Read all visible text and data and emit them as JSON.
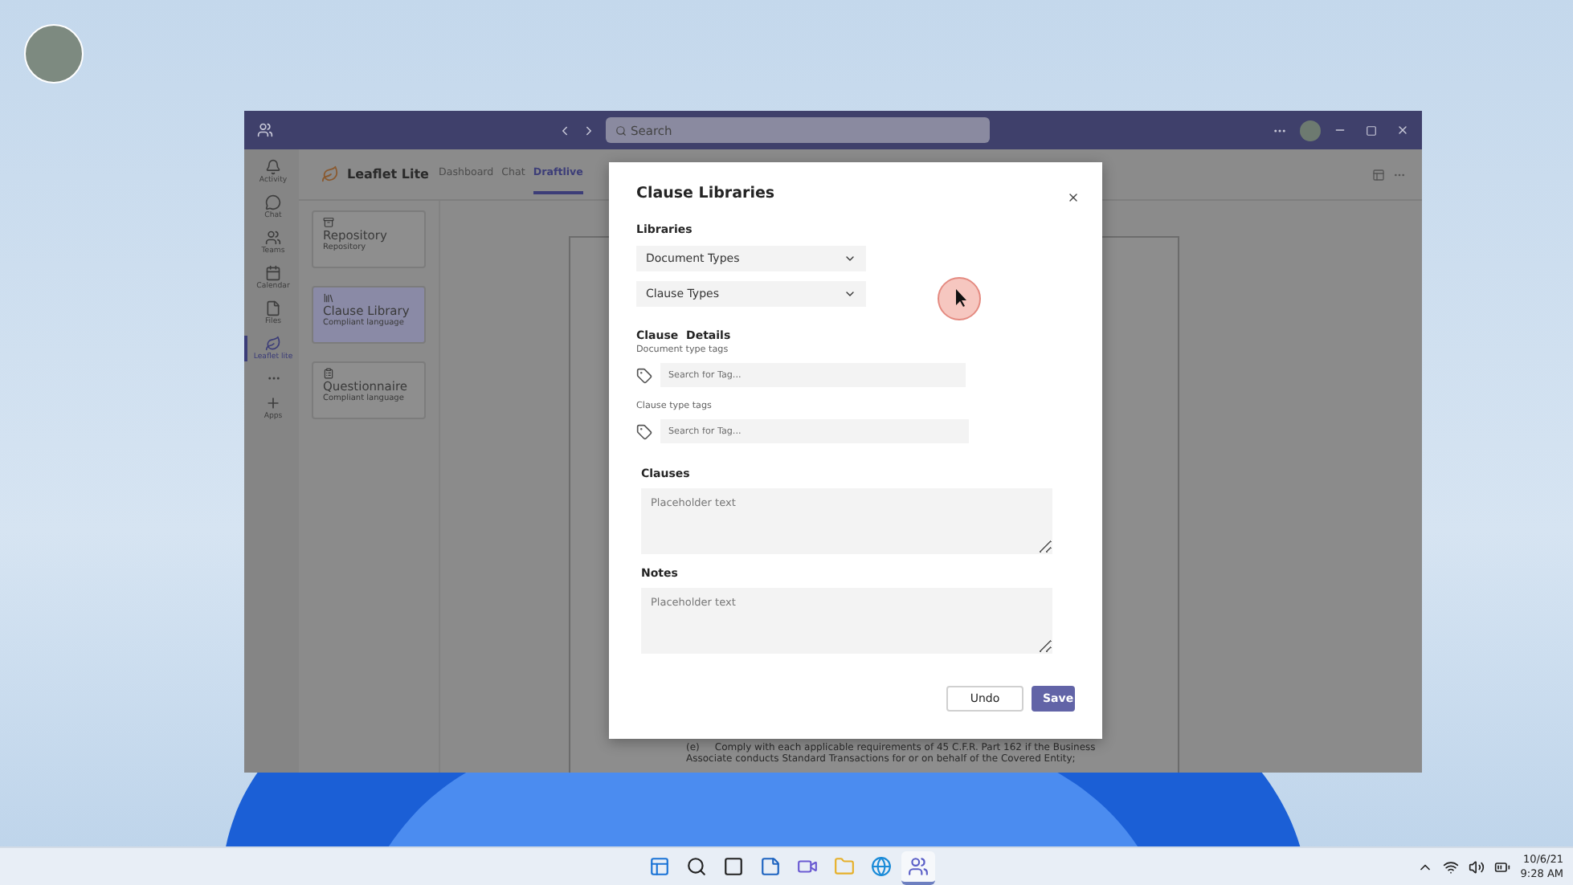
{
  "window": {
    "search": {
      "placeholder": "Search"
    }
  },
  "rail": [
    {
      "label": "Activity",
      "kind": "bell",
      "selected": false
    },
    {
      "label": "Chat",
      "kind": "chat",
      "selected": false
    },
    {
      "label": "Teams",
      "kind": "teams",
      "selected": false
    },
    {
      "label": "Calendar",
      "kind": "calendar",
      "selected": false
    },
    {
      "label": "Files",
      "kind": "file",
      "selected": false
    },
    {
      "label": "Leaflet lite",
      "kind": "leaf",
      "selected": true
    },
    {
      "kind": "more",
      "selected": false
    },
    {
      "label": "Apps",
      "kind": "plus",
      "selected": false
    }
  ],
  "app": {
    "name": "Leaflet Lite",
    "tabs": [
      {
        "label": "Dashboard",
        "selected": false
      },
      {
        "label": "Chat",
        "selected": false
      },
      {
        "label": "Draftlive",
        "selected": true
      }
    ]
  },
  "cards": [
    {
      "title": "Repository",
      "subtitle": "Repository",
      "kind": "archive",
      "selected": false
    },
    {
      "title": "Clause Library",
      "subtitle": "Compliant language",
      "kind": "library",
      "selected": true
    },
    {
      "title": "Questionnaire",
      "subtitle": "Compliant language",
      "kind": "clipboard",
      "selected": false
    }
  ],
  "document": {
    "lines": [
      "(e)     Comply with each applicable requirements of 45 C.F.R. Part 162 if the Business",
      "Associate conducts Standard Transactions for or on behalf of the Covered Entity;"
    ]
  },
  "dialog": {
    "title": "Clause Libraries",
    "libraries_label": "Libraries",
    "dropdowns": [
      "Document Types",
      "Clause Types"
    ],
    "details_heading": "Clause  Details",
    "tag_fields": [
      {
        "label": "Document type tags",
        "placeholder": "Search for Tag..."
      },
      {
        "label": "Clause type tags",
        "placeholder": "Search for Tag..."
      }
    ],
    "text_areas": [
      {
        "label": "Clauses",
        "placeholder": "Placeholder text"
      },
      {
        "label": "Notes",
        "placeholder": "Placeholder text"
      }
    ],
    "buttons": [
      {
        "label": "Undo",
        "kind": "secondary"
      },
      {
        "label": "Save",
        "kind": "primary"
      }
    ]
  },
  "taskbar": {
    "apps": [
      {
        "kind": "start",
        "selected": false
      },
      {
        "kind": "search",
        "selected": false
      },
      {
        "kind": "taskview",
        "selected": false
      },
      {
        "kind": "widgets",
        "selected": false
      },
      {
        "kind": "chat",
        "selected": false
      },
      {
        "kind": "folder",
        "selected": false
      },
      {
        "kind": "browser",
        "selected": false
      },
      {
        "kind": "teams",
        "selected": true
      }
    ],
    "date": "10/6/21",
    "time": "9:28 AM"
  }
}
